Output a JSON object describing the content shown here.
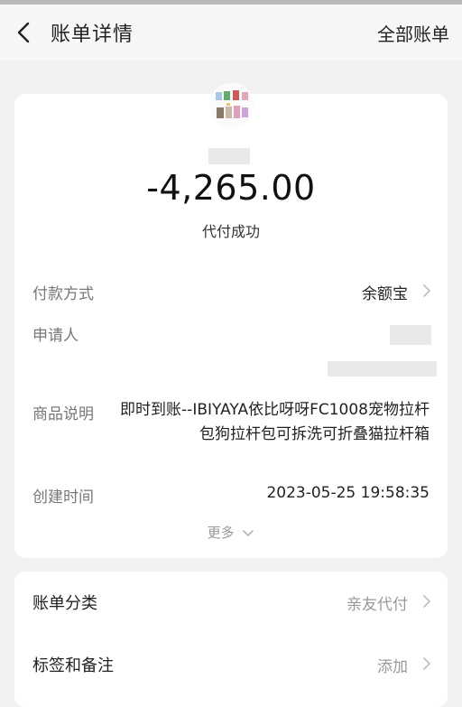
{
  "header": {
    "title": "账单详情",
    "right_link": "全部账单"
  },
  "summary": {
    "amount": "-4,265.00",
    "status": "代付成功"
  },
  "details": {
    "payment_method_label": "付款方式",
    "payment_method_value": "余额宝",
    "applicant_label": "申请人",
    "product_label": "商品说明",
    "product_value": "即时到账--IBIYAYA依比呀呀FC1008宠物拉杆包狗拉杆包可拆洗可折叠猫拉杆箱",
    "created_label": "创建时间",
    "created_value": "2023-05-25 19:58:35",
    "more_label": "更多"
  },
  "extra": {
    "category_label": "账单分类",
    "category_value": "亲友代付",
    "tags_label": "标签和备注",
    "tags_value": "添加"
  },
  "icons": {
    "back": "chevron-left-icon",
    "row_arrow": "chevron-right-icon",
    "more_arrow": "chevron-down-icon"
  }
}
